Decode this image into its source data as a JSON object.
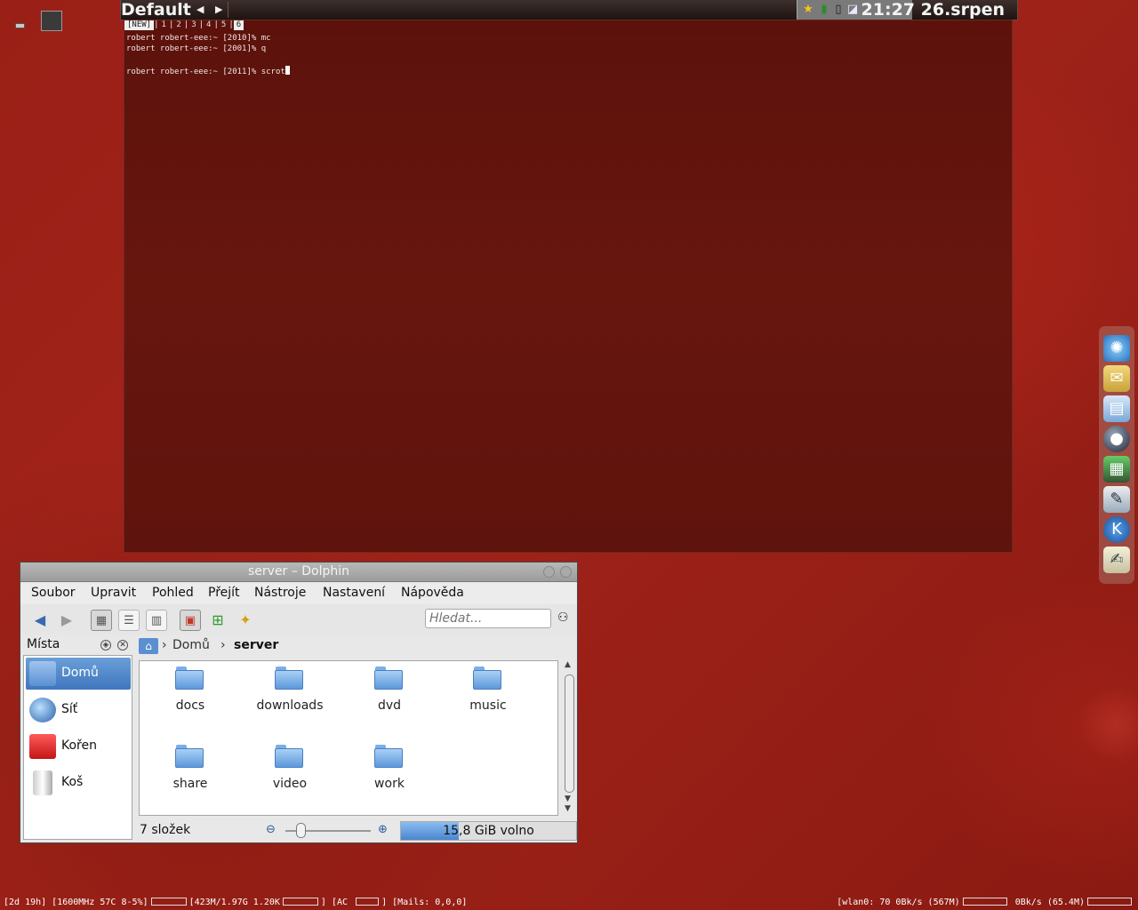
{
  "topbar": {
    "workspace_title": "Default",
    "prev_arrow": "◀",
    "next_arrow": "▶",
    "clock": "21:27 26.srpen",
    "tray_icons": [
      "star-icon",
      "monitor-icon",
      "battery-icon",
      "network-icon"
    ]
  },
  "terminal": {
    "tabs": [
      "[NEW]",
      "1",
      "2",
      "3",
      "4",
      "5",
      "6"
    ],
    "active_tab": "6",
    "lines": [
      "robert robert-eee:~ [2010]% mc",
      "robert robert-eee:~ [2001]% q",
      "",
      "robert robert-eee:~ [2011]% scrot"
    ]
  },
  "dolphin": {
    "window_title": "server – Dolphin",
    "menu": [
      "Soubor",
      "Upravit",
      "Pohled",
      "Přejít",
      "Nástroje",
      "Nastavení",
      "Nápověda"
    ],
    "search_placeholder": "Hledat...",
    "places_title": "Místa",
    "places": [
      {
        "label": "Domů",
        "icon": "home-folder-icon",
        "selected": true
      },
      {
        "label": "Síť",
        "icon": "network-globe-icon",
        "selected": false
      },
      {
        "label": "Kořen",
        "icon": "root-folder-icon",
        "selected": false
      },
      {
        "label": "Koš",
        "icon": "trash-icon",
        "selected": false
      }
    ],
    "breadcrumb": {
      "parent": "Domů",
      "current": "server"
    },
    "files": [
      "docs",
      "downloads",
      "dvd",
      "music",
      "share",
      "video",
      "work"
    ],
    "status_text": "7 složek",
    "free_space": "15,8 GiB volno",
    "free_space_used_fraction": 0.33
  },
  "dock_items": [
    "kde-network-icon",
    "mail-icon",
    "text-editor-icon",
    "media-player-icon",
    "spreadsheet-icon",
    "writer-icon",
    "kde-app-icon",
    "notes-icon"
  ],
  "bottom_status": {
    "left": "[2d 19h] [1600MHz 57C 8-5%]",
    "mem": "[423M/1.97G 1.20K",
    "power": "] [AC",
    "mails": "] [Mails: 0,0,0]",
    "net_down": "[wlan0: 70 0Bk/s (567M)",
    "net_up": "0Bk/s (65.4M)"
  },
  "colors": {
    "desktop": "#8e1a12",
    "terminal_bg": "#5c120b",
    "selection": "#3f76bd"
  }
}
